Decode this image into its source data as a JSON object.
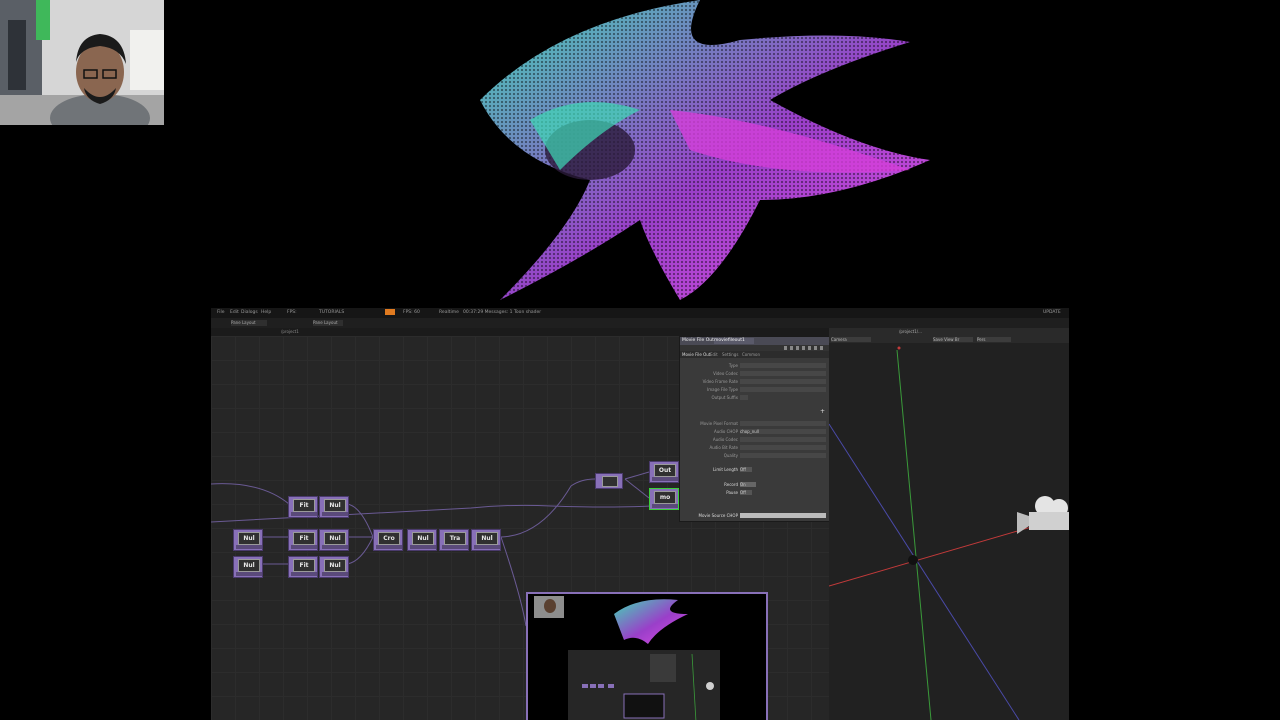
{
  "menu": {
    "items": [
      "File",
      "Edit",
      "Dialogs",
      "Help"
    ],
    "fields": [
      "FPS:",
      "TUTORIALS",
      "FPS: 60",
      "Realtime",
      "00:37:29 Messages: 1 Toon shader"
    ],
    "right_label": "UPDATE"
  },
  "tabs": [
    "Pane Layout",
    "Pane Layout"
  ],
  "path": "/project1",
  "view_path": "/project1/...",
  "params": {
    "title": "Movie File Out",
    "op_name": "moviefileout1",
    "tabs": [
      "Movie File Out",
      "Edit",
      "Settings",
      "Common"
    ],
    "rows": [
      {
        "label": "Type",
        "value": ""
      },
      {
        "label": "Video Codec",
        "value": ""
      },
      {
        "label": "Video Frame Rate",
        "value": ""
      },
      {
        "label": "Image File Type",
        "value": ""
      },
      {
        "label": "Output Suffix",
        "value": ""
      },
      {
        "label": "Movie Pixel Format",
        "value": ""
      },
      {
        "label": "Audio CHOP",
        "value": "chop_null"
      },
      {
        "label": "Audio Codec",
        "value": ""
      },
      {
        "label": "Audio Bit Rate",
        "value": ""
      },
      {
        "label": "Quality",
        "value": ""
      },
      {
        "label": "Limit Length",
        "value": "Off"
      },
      {
        "label": "Record",
        "value": "On"
      },
      {
        "label": "Pause",
        "value": "Off"
      },
      {
        "label": "Movie Source CHOP",
        "value": ""
      }
    ]
  },
  "viewer": {
    "camera_field": "Camera",
    "view_field": "Save View Br",
    "persp_field": "Pers"
  },
  "nodes": [
    {
      "name": "Fit"
    },
    {
      "name": "Nul"
    },
    {
      "name": "Nul"
    },
    {
      "name": "Fit"
    },
    {
      "name": "Nul"
    },
    {
      "name": "Cro"
    },
    {
      "name": "Nul"
    },
    {
      "name": "Tra"
    },
    {
      "name": "Nul"
    },
    {
      "name": "Nul"
    },
    {
      "name": "Fit"
    },
    {
      "name": "Nul"
    },
    {
      "name": "Out"
    },
    {
      "name": "mo"
    }
  ],
  "colors": {
    "node": "#8870b8",
    "render_teal": "#3fd9b5",
    "render_magenta": "#d43fd9",
    "axis_green": "#3a9a3a",
    "axis_red": "#c23a3a",
    "axis_blue": "#4a4aa8"
  }
}
